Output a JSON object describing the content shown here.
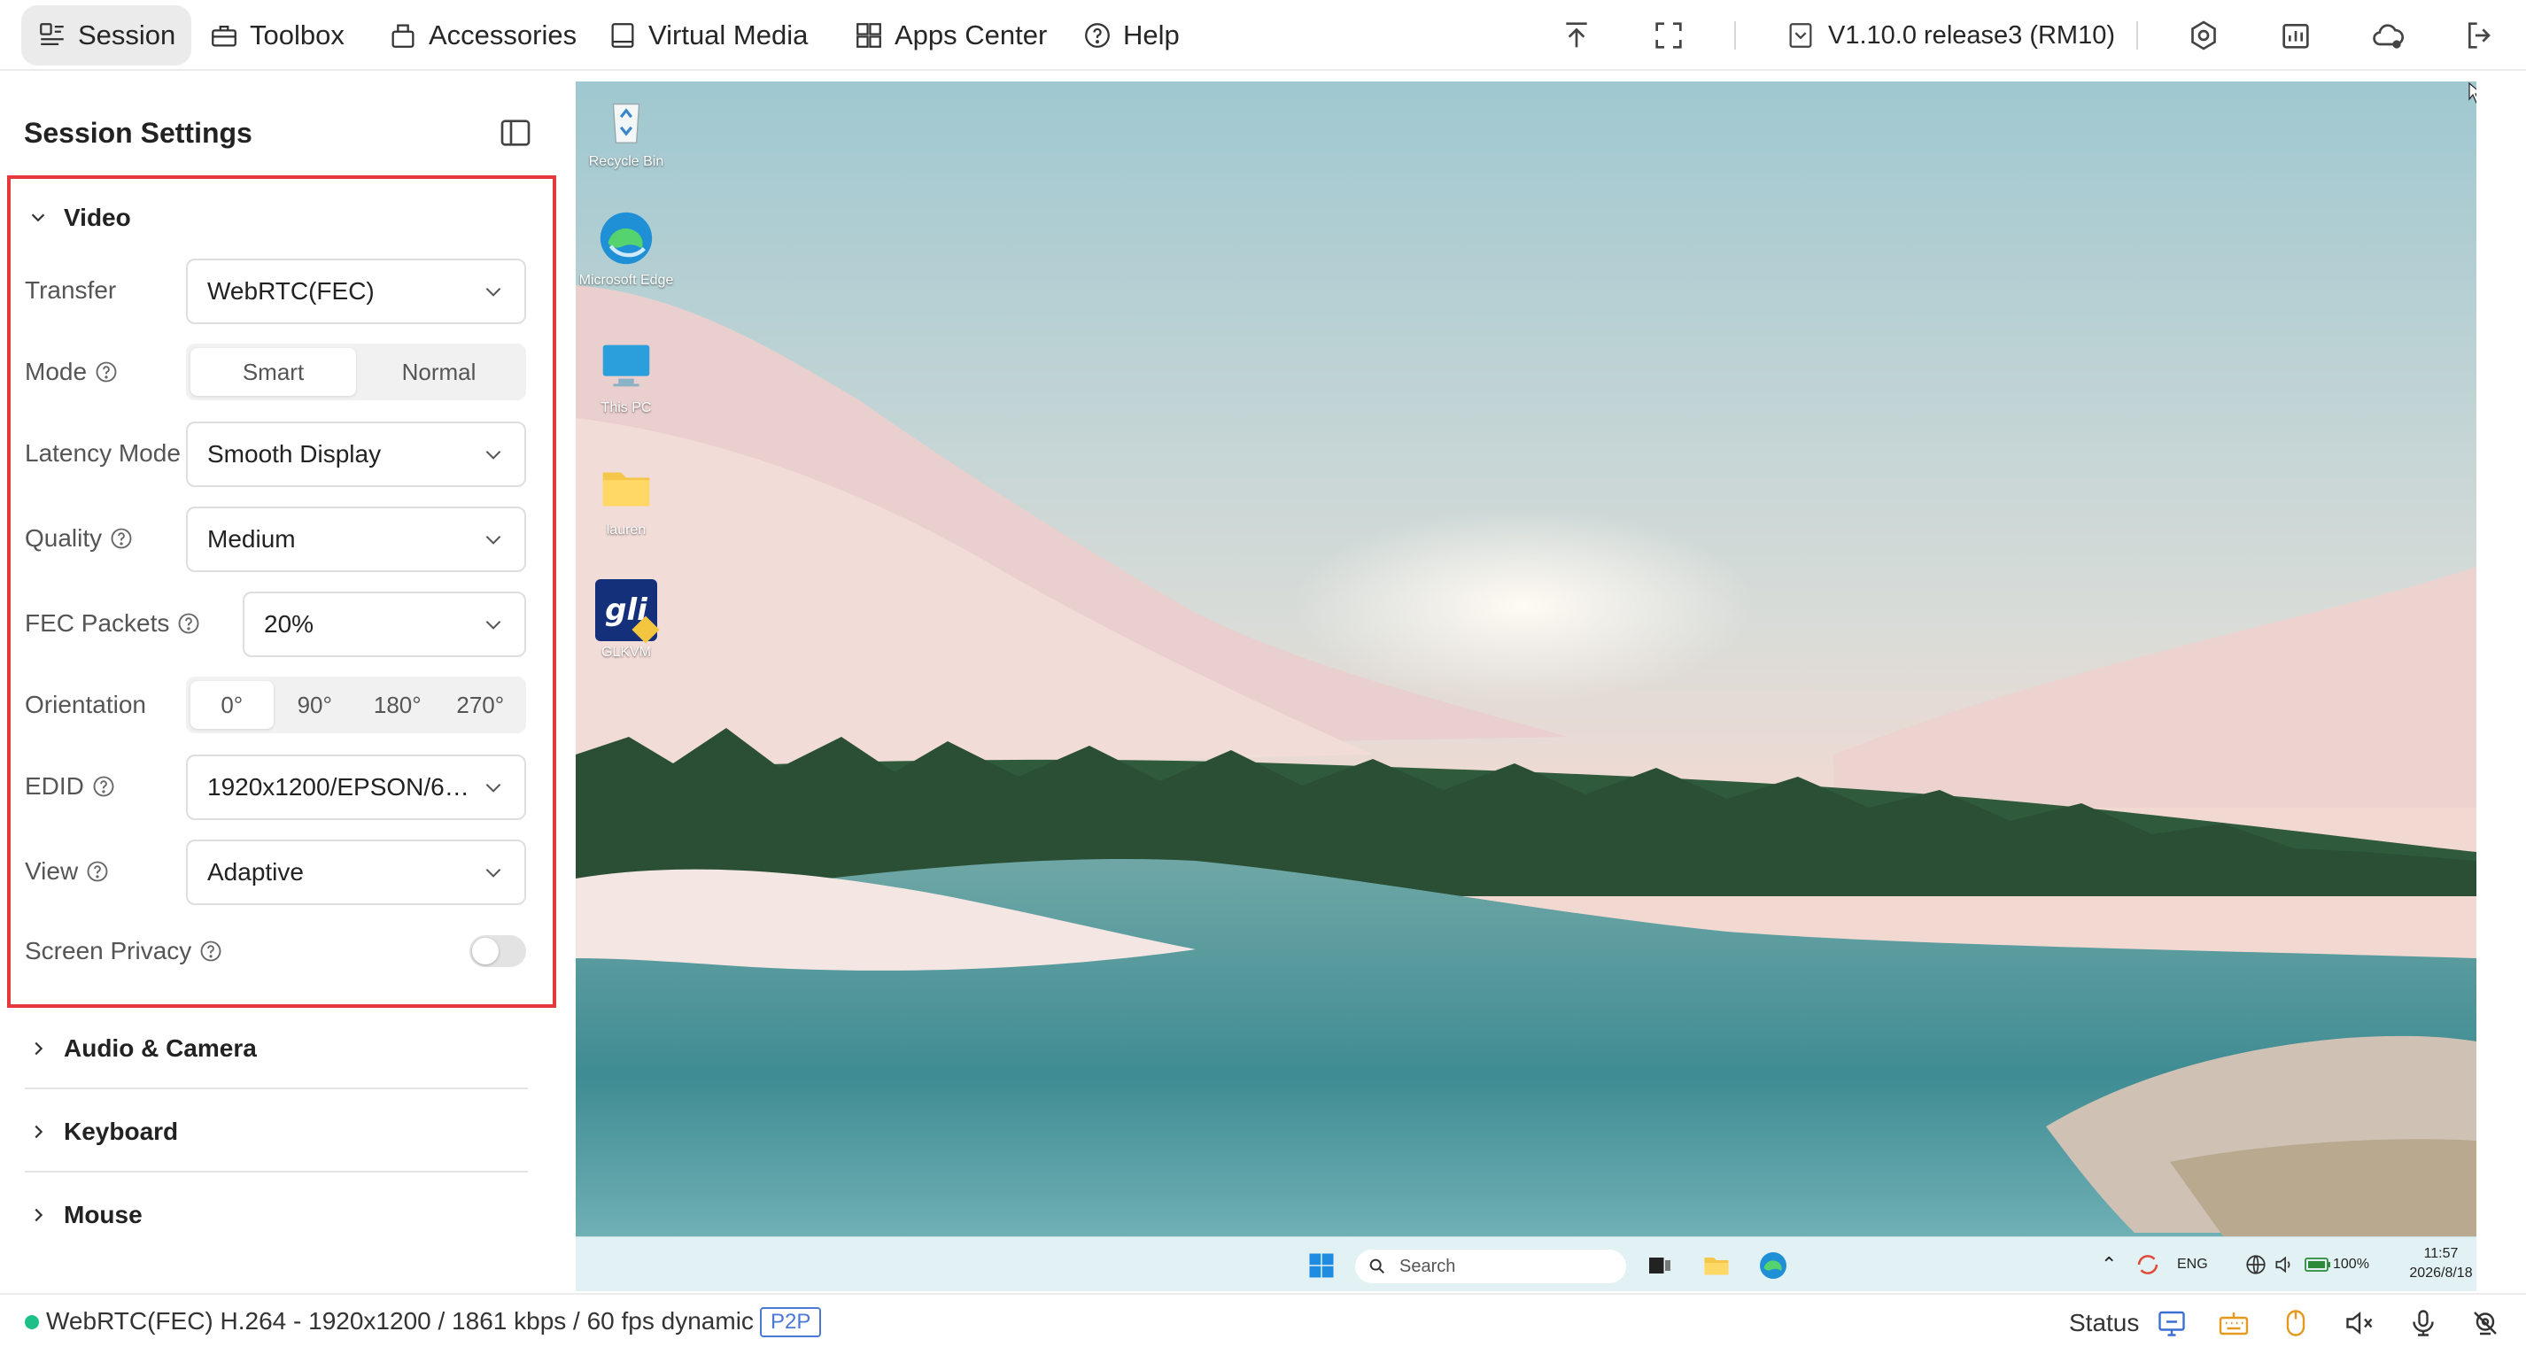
{
  "menu": {
    "items": [
      {
        "label": "Session",
        "icon": "session-icon"
      },
      {
        "label": "Toolbox",
        "icon": "toolbox-icon"
      },
      {
        "label": "Accessories",
        "icon": "accessories-icon"
      },
      {
        "label": "Virtual Media",
        "icon": "virtual-media-icon"
      },
      {
        "label": "Apps Center",
        "icon": "apps-center-icon"
      },
      {
        "label": "Help",
        "icon": "help-icon"
      }
    ],
    "active": "Session",
    "version": "V1.10.0 release3 (RM10)"
  },
  "sidebar": {
    "title": "Session Settings",
    "video": {
      "title": "Video",
      "transfer": {
        "label": "Transfer",
        "value": "WebRTC(FEC)"
      },
      "mode": {
        "label": "Mode",
        "options": [
          "Smart",
          "Normal"
        ],
        "selected": "Smart"
      },
      "latency": {
        "label": "Latency Mode",
        "value": "Smooth Display"
      },
      "quality": {
        "label": "Quality",
        "value": "Medium"
      },
      "fec": {
        "label": "FEC Packets",
        "value": "20%"
      },
      "orientation": {
        "label": "Orientation",
        "options": [
          "0°",
          "90°",
          "180°",
          "270°"
        ],
        "selected": "0°"
      },
      "edid": {
        "label": "EDID",
        "value": "1920x1200/EPSON/60..."
      },
      "view": {
        "label": "View",
        "value": "Adaptive"
      },
      "privacy": {
        "label": "Screen Privacy",
        "enabled": false
      }
    },
    "sections": [
      "Audio & Camera",
      "Keyboard",
      "Mouse"
    ]
  },
  "desktop": {
    "icons": [
      "Recycle Bin",
      "Microsoft Edge",
      "This PC",
      "lauren",
      "GLKVM"
    ],
    "gl_badge": "gli",
    "taskbar": {
      "search": "Search",
      "lang": "ENG",
      "battery": "100%",
      "time": "11:57",
      "date": "2026/8/18"
    }
  },
  "status": {
    "text": "WebRTC(FEC) H.264 - 1920x1200  /  1861 kbps / 60 fps dynamic",
    "badge": "P2P",
    "label": "Status"
  },
  "colors": {
    "accent_red": "#e5383b",
    "status_green": "#1ec08a",
    "p2p_blue": "#4a78d6"
  }
}
